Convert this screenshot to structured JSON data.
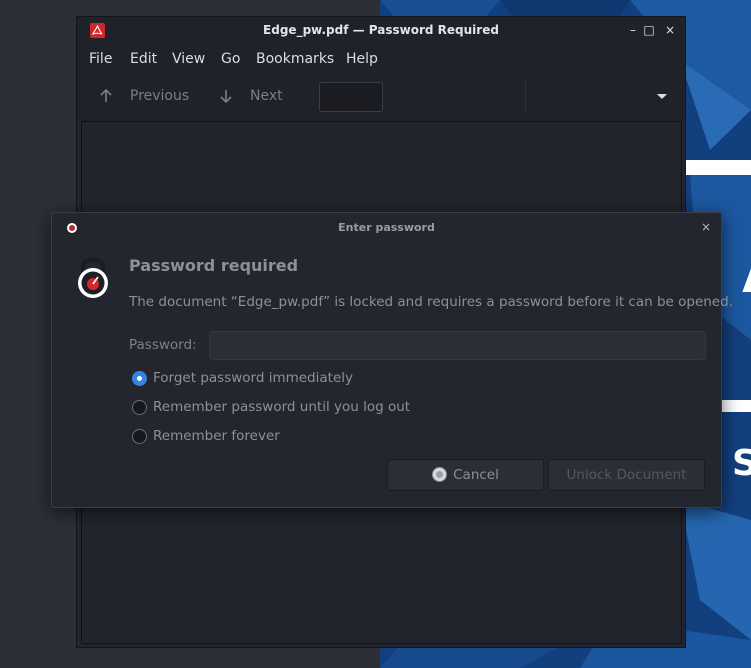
{
  "wallpaper": {
    "letter_a": "A",
    "letter_s": "S"
  },
  "main_window": {
    "title": "Edge_pw.pdf — Password Required",
    "minimize_glyph": "–",
    "maximize_glyph": "□",
    "close_glyph": "×",
    "menu": [
      "File",
      "Edit",
      "View",
      "Go",
      "Bookmarks",
      "Help"
    ],
    "toolbar": {
      "previous_label": "Previous",
      "next_label": "Next",
      "page_entry_value": ""
    }
  },
  "dialog": {
    "title": "Enter password",
    "close_glyph": "×",
    "heading": "Password required",
    "message": "The document “Edge_pw.pdf” is locked and requires a password before it can be opened.",
    "password_label": "Password:",
    "password_value": "",
    "options": [
      {
        "label": "Forget password immediately",
        "checked": true
      },
      {
        "label": "Remember password until you log out",
        "checked": false
      },
      {
        "label": "Remember forever",
        "checked": false
      }
    ],
    "cancel_label": "Cancel",
    "unlock_label": "Unlock Document"
  },
  "colors": {
    "accent": "#3584e4",
    "pdf_red": "#d1272b",
    "wallpaper_blue": "#123f7d"
  },
  "icons": {
    "app": "pdf-icon",
    "lock": "lock-icon",
    "cancel": "cancel-icon",
    "previous": "arrow-up-icon",
    "next": "arrow-down-icon"
  }
}
